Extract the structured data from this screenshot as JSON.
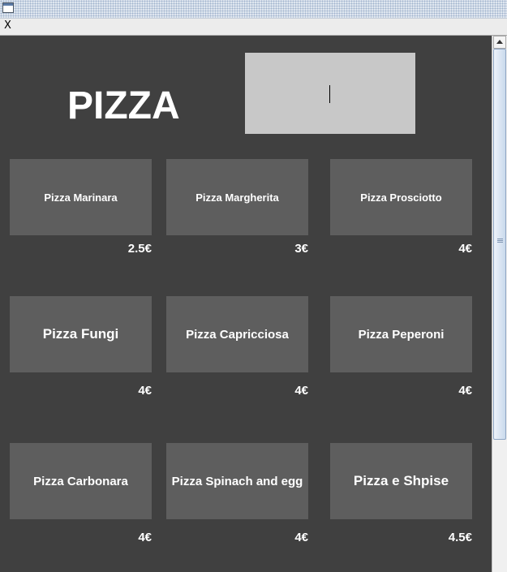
{
  "window": {
    "title": ""
  },
  "menubar": {
    "close_label": "X"
  },
  "header": {
    "title": "PIZZA"
  },
  "search": {
    "value": ""
  },
  "pizzas": [
    {
      "name": "Pizza Marinara",
      "price": "2.5€"
    },
    {
      "name": "Pizza Margherita",
      "price": "3€"
    },
    {
      "name": "Pizza Prosciotto",
      "price": "4€"
    },
    {
      "name": "Pizza Fungi",
      "price": "4€"
    },
    {
      "name": "Pizza Capricciosa",
      "price": "4€"
    },
    {
      "name": "Pizza Peperoni",
      "price": "4€"
    },
    {
      "name": "Pizza Carbonara",
      "price": "4€"
    },
    {
      "name": "Pizza Spinach and egg",
      "price": "4€"
    },
    {
      "name": "Pizza e Shpise",
      "price": "4.5€"
    }
  ],
  "colors": {
    "panel_bg": "#404040",
    "button_bg": "#5e5e5e",
    "textbox_bg": "#c8c8c8",
    "text": "#ffffff"
  }
}
